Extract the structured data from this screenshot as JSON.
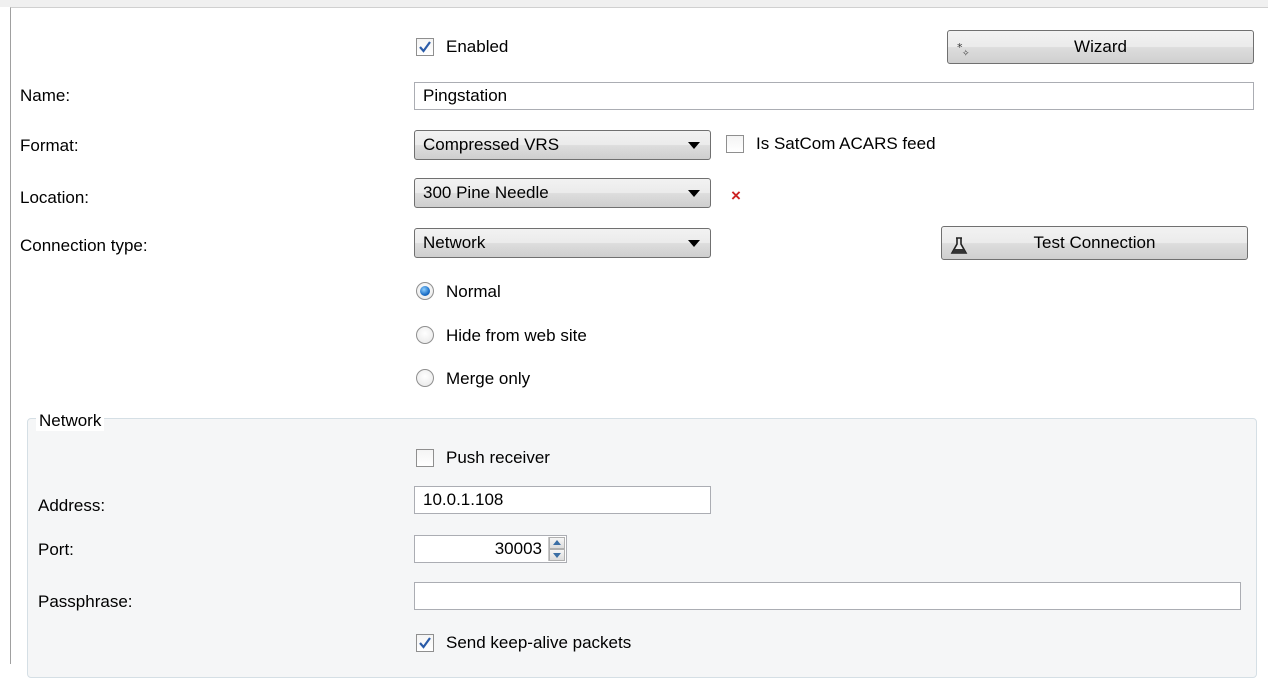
{
  "form": {
    "enabled": {
      "label": "Enabled",
      "checked": true
    },
    "wizard_button": "Wizard",
    "name": {
      "label": "Name:",
      "value": "Pingstation"
    },
    "format": {
      "label": "Format:",
      "selected": "Compressed VRS"
    },
    "satcom": {
      "label": "Is SatCom ACARS feed",
      "checked": false
    },
    "location": {
      "label": "Location:",
      "selected": "300 Pine Needle",
      "clear_glyph": "×"
    },
    "connection_type": {
      "label": "Connection type:",
      "selected": "Network"
    },
    "test_connection_button": "Test Connection",
    "visibility_options": [
      {
        "label": "Normal",
        "selected": true
      },
      {
        "label": "Hide from web site",
        "selected": false
      },
      {
        "label": "Merge only",
        "selected": false
      }
    ]
  },
  "network": {
    "title": "Network",
    "push_receiver": {
      "label": "Push receiver",
      "checked": false
    },
    "address": {
      "label": "Address:",
      "value": "10.0.1.108"
    },
    "port": {
      "label": "Port:",
      "value": "30003"
    },
    "passphrase": {
      "label": "Passphrase:",
      "value": ""
    },
    "keep_alive": {
      "label": "Send keep-alive packets",
      "checked": true
    }
  },
  "colors": {
    "check_mark": "#2a5ba8",
    "clear_x": "#cc2222",
    "group_border": "#d5dfe5"
  },
  "icons": {
    "wizard": "wand-sparkle-icon",
    "test_connection": "flask-icon"
  }
}
